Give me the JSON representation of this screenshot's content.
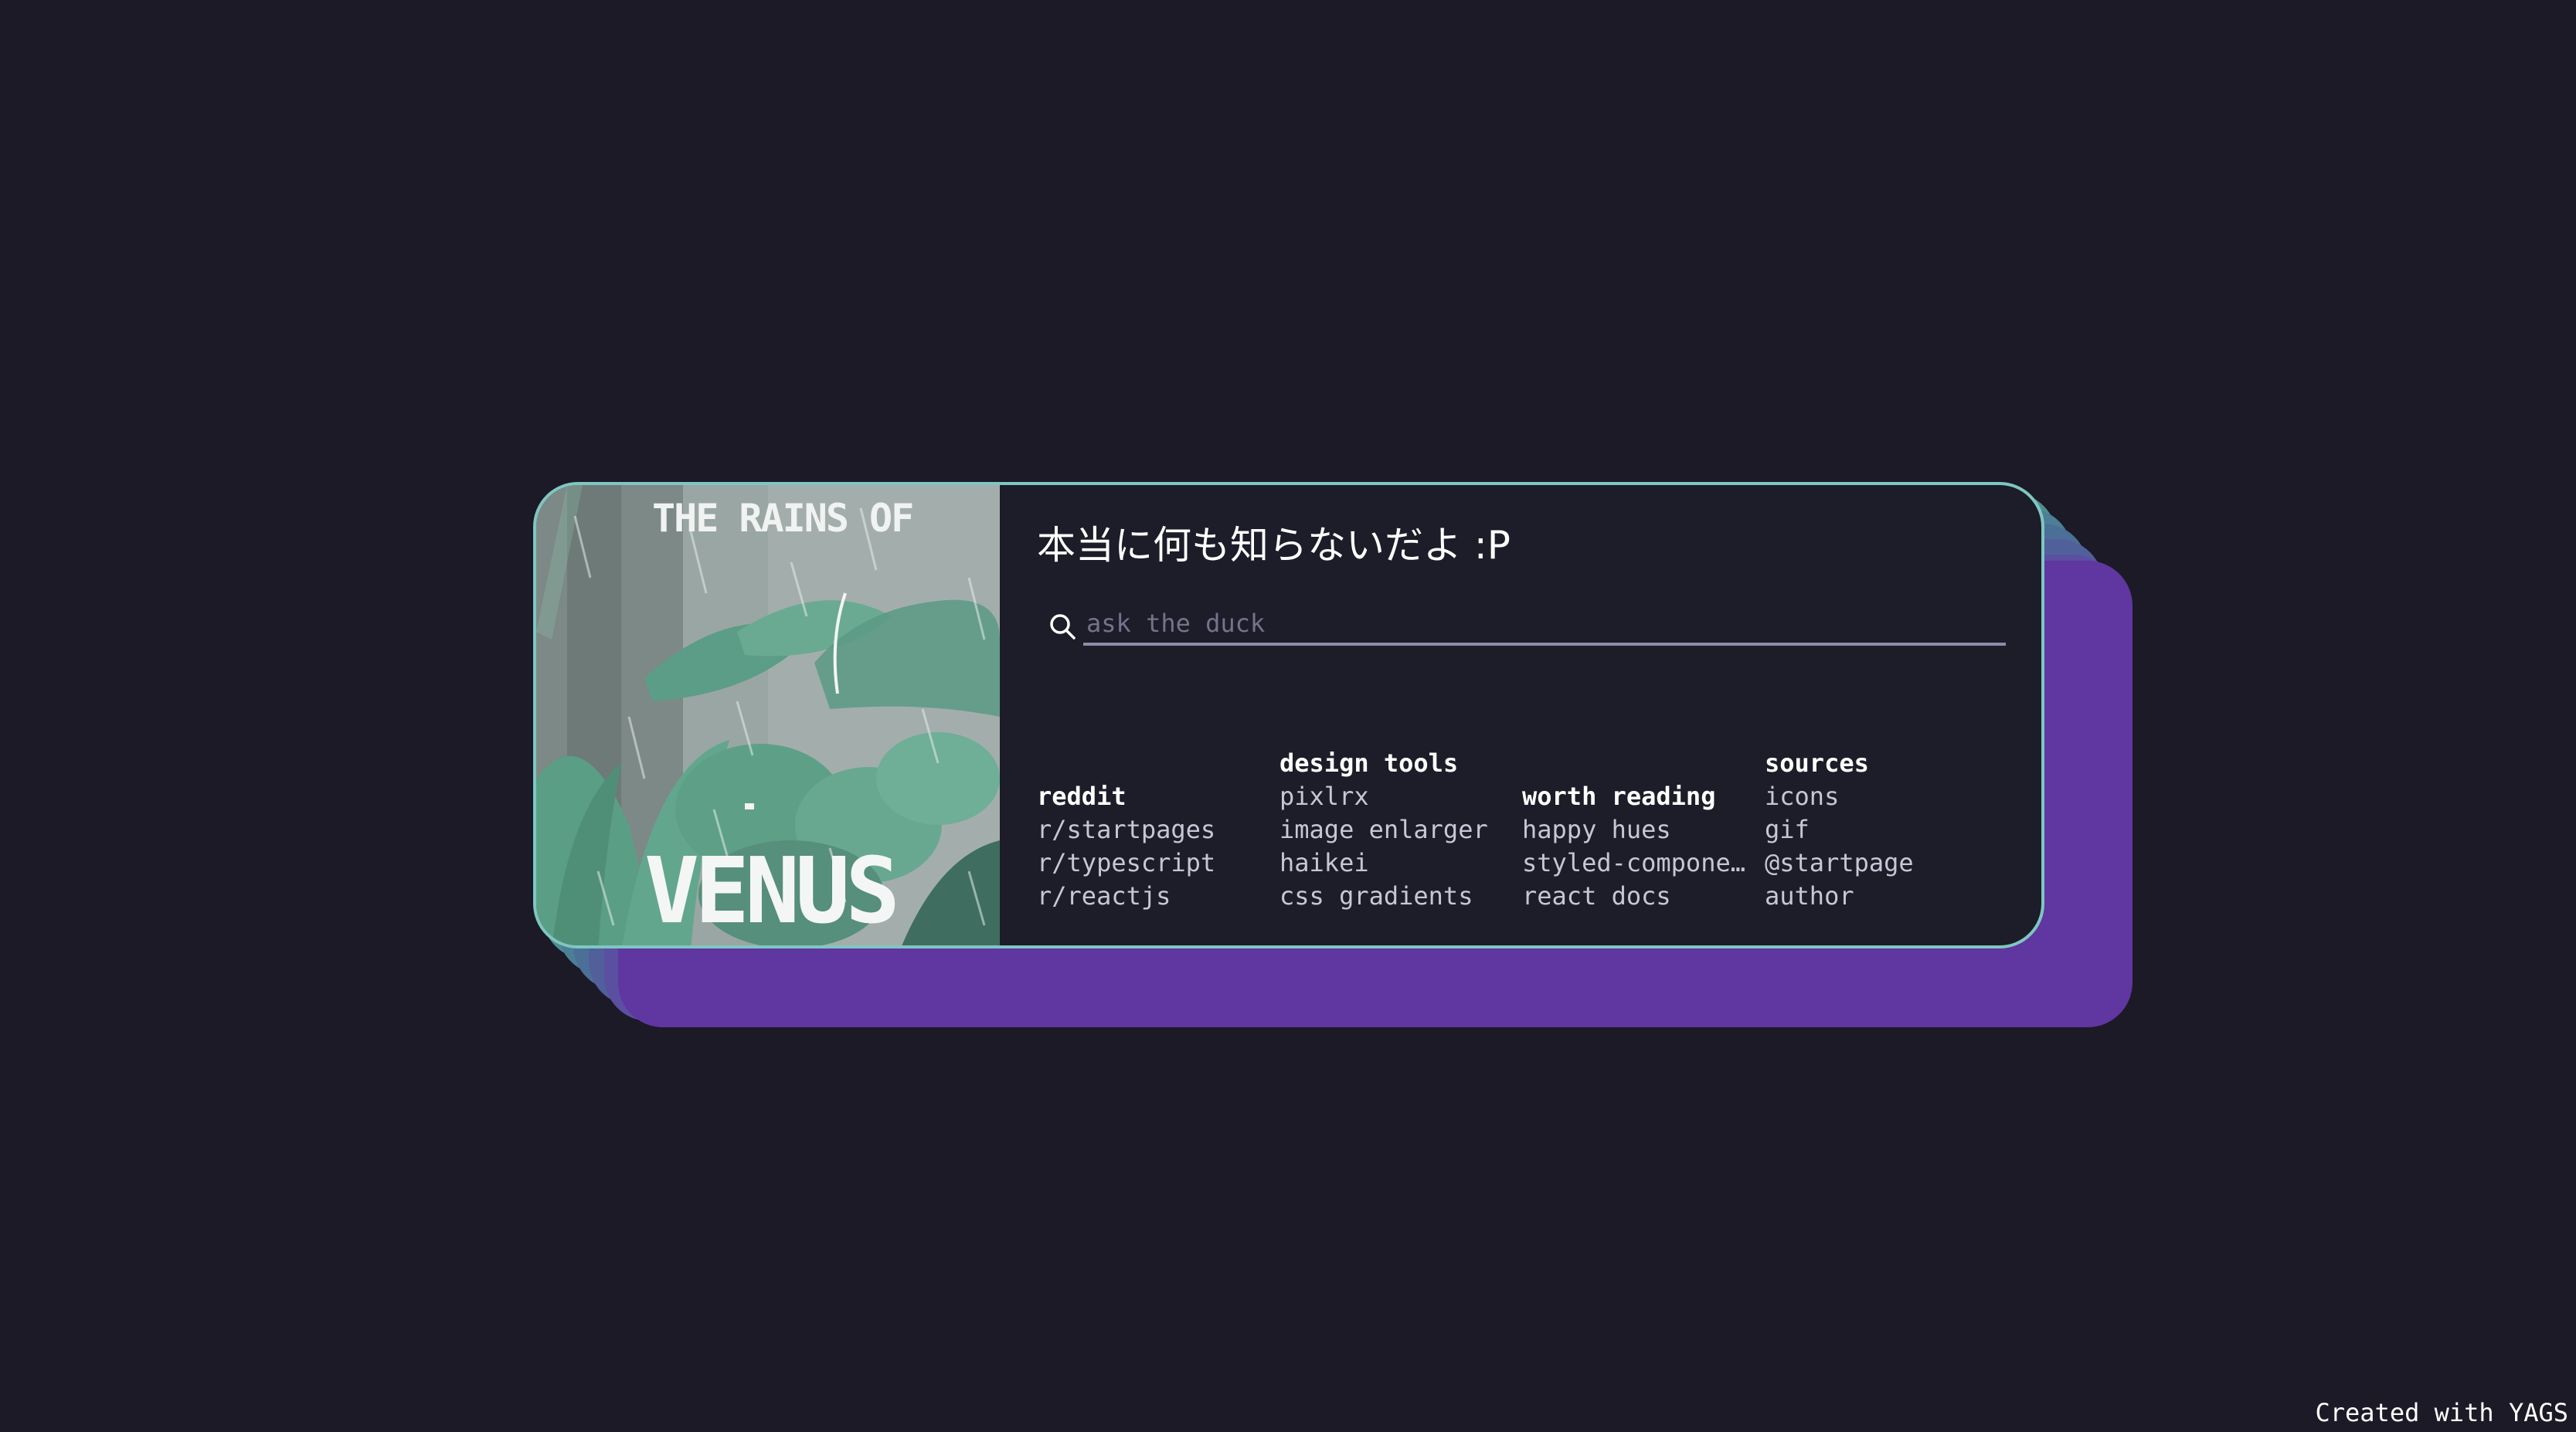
{
  "art": {
    "title_small": "THE RAINS OF",
    "title_big": "VENUS"
  },
  "greeting": "本当に何も知らないだよ :P",
  "search": {
    "placeholder": "ask the duck",
    "value": ""
  },
  "columns": [
    {
      "title": "reddit",
      "links": [
        "r/startpages",
        "r/typescript",
        "r/reactjs"
      ]
    },
    {
      "title": "design tools",
      "links": [
        "pixlrx",
        "image enlarger",
        "haikei",
        "css gradients"
      ]
    },
    {
      "title": "worth reading",
      "links": [
        "happy hues",
        "styled-compone…",
        "react docs"
      ]
    },
    {
      "title": "sources",
      "links": [
        "icons",
        "gif",
        "@startpage",
        "author"
      ]
    }
  ],
  "footer": "Created with YAGS",
  "colors": {
    "background": "#1b1a26",
    "card": "#1d1c29",
    "card_border": "#7fc6c0",
    "shadow_top": "#4f8e93",
    "shadow_bottom": "#6036a0"
  }
}
